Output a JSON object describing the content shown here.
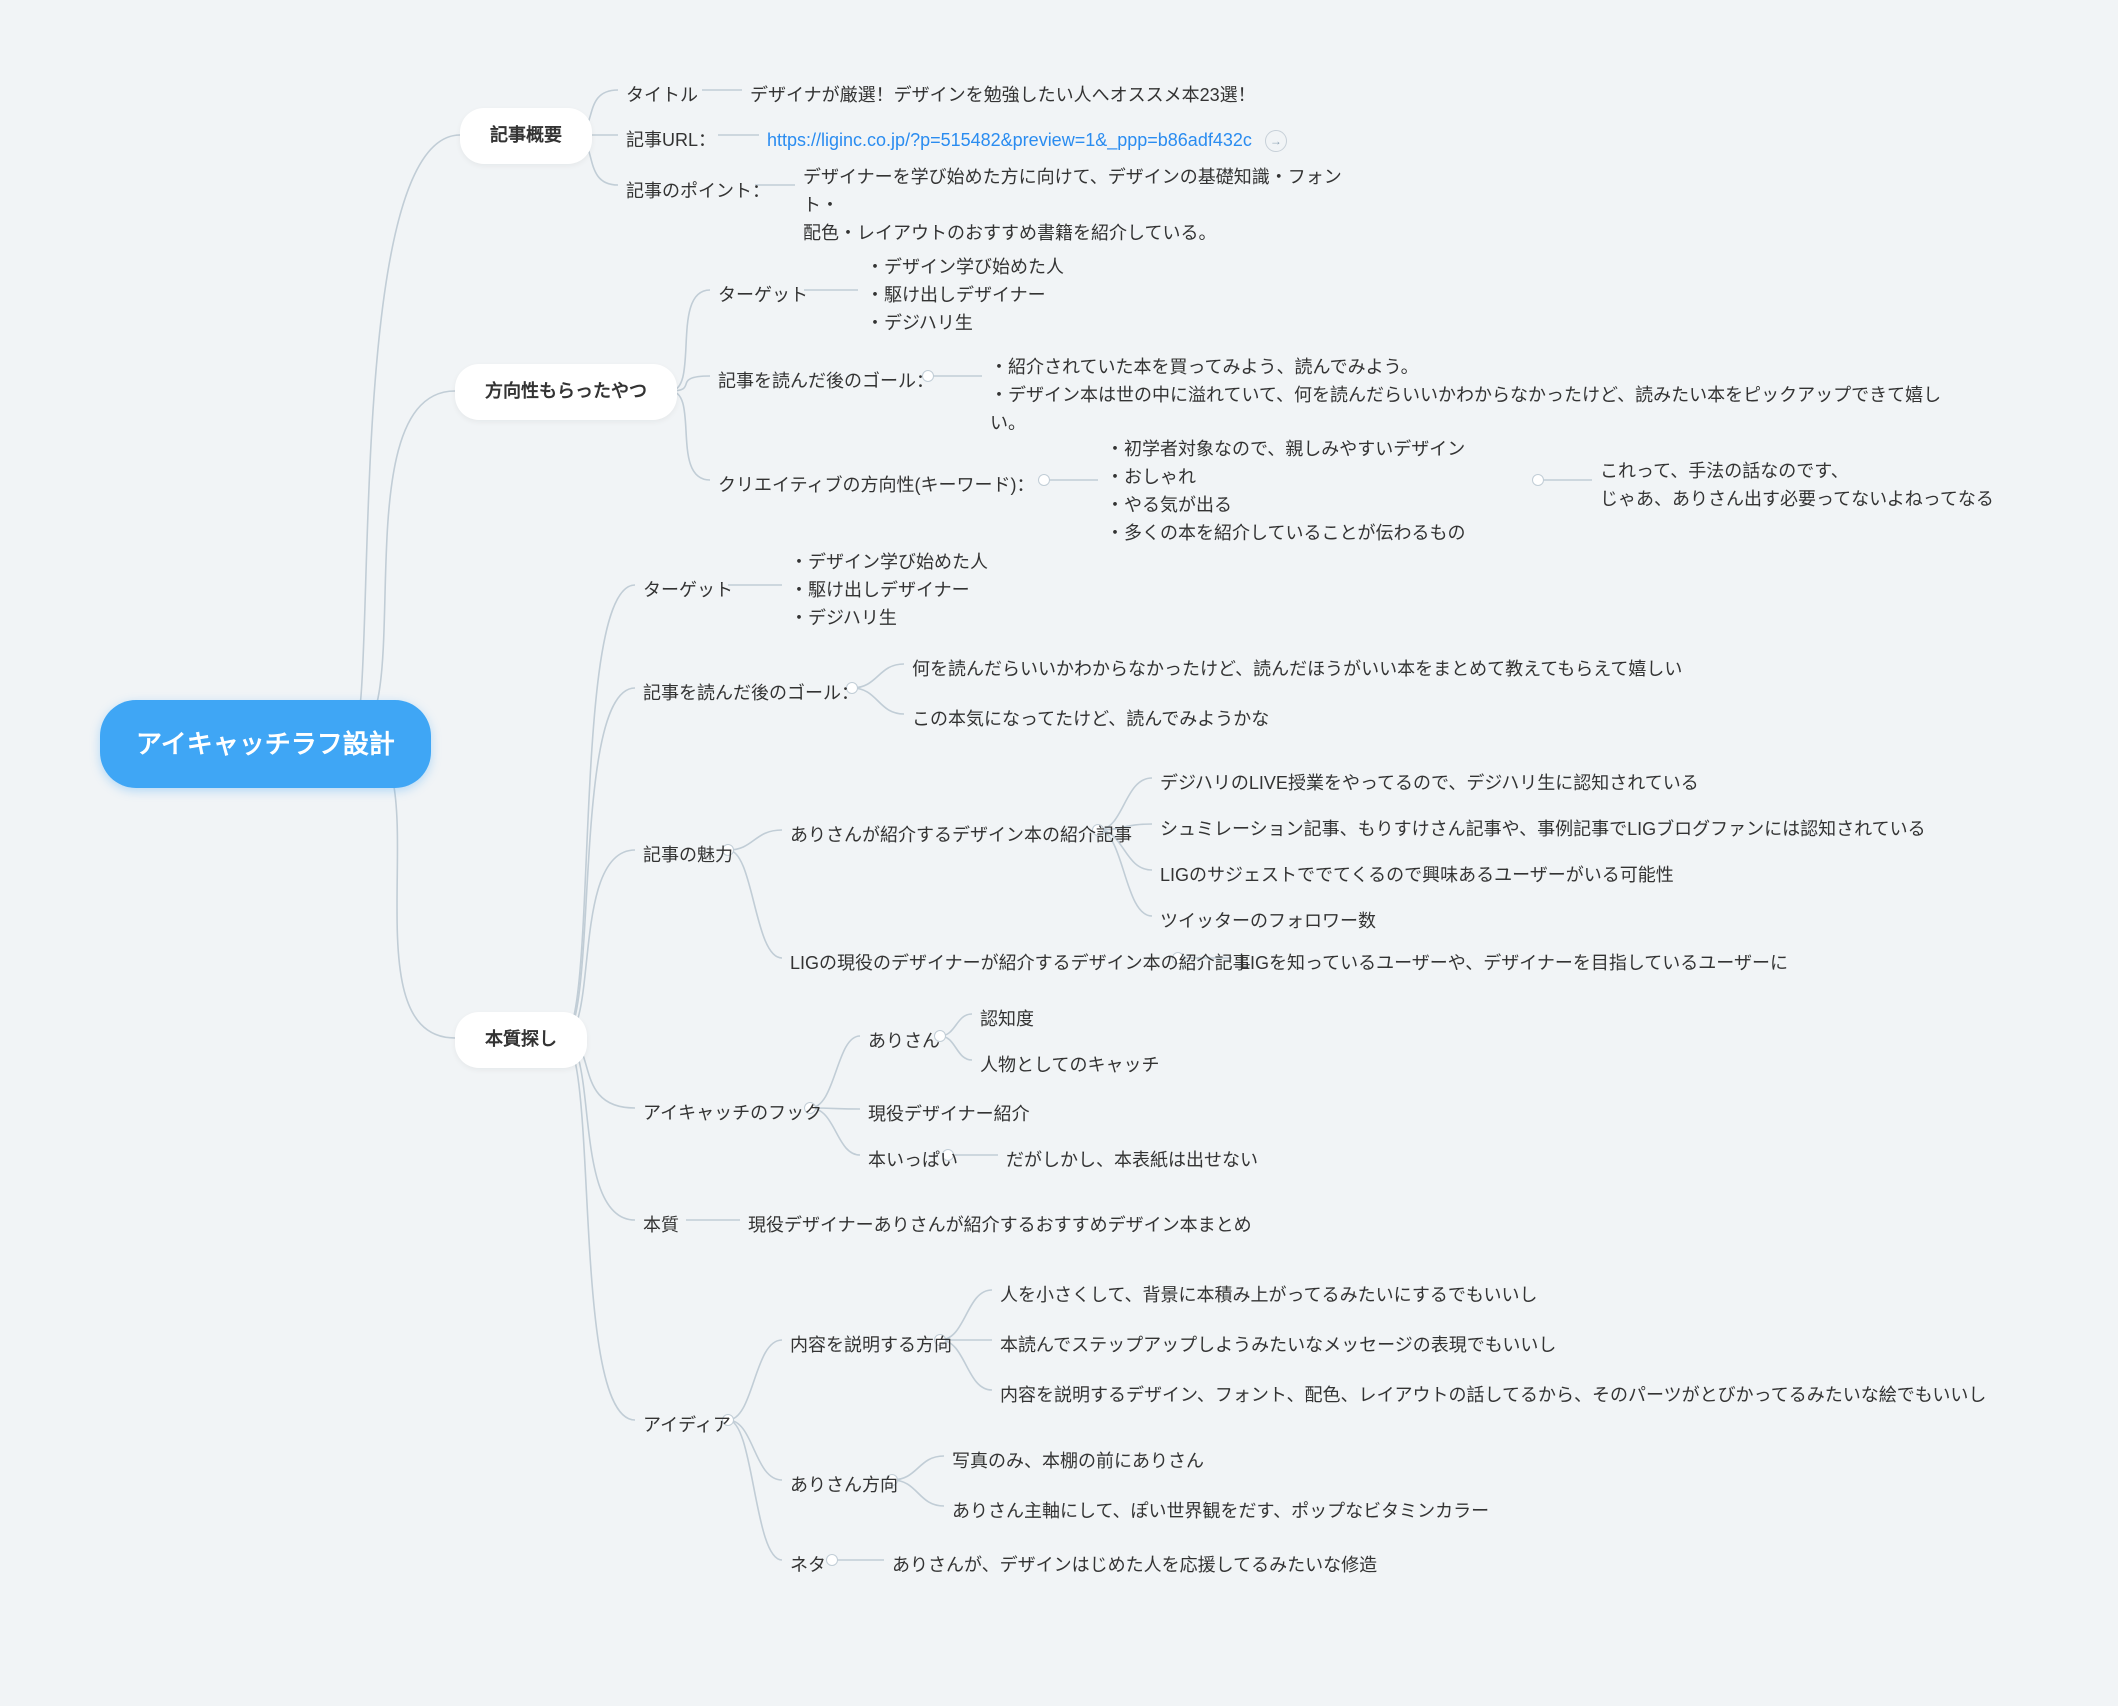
{
  "root": "アイキャッチラフ設計",
  "l1": {
    "overview": "記事概要",
    "direction": "方向性もらったやつ",
    "essence": "本質探し"
  },
  "overview": {
    "title_lbl": "タイトル",
    "title_val": "デザイナが厳選！デザインを勉強したい人へオススメ本23選！",
    "url_lbl": "記事URL：",
    "url_val": "https://liginc.co.jp/?p=515482&preview=1&_ppp=b86adf432c",
    "point_lbl": "記事のポイント：",
    "point_val": "デザイナーを学び始めた方に向けて、デザインの基礎知識・フォント・\n配色・レイアウトのおすすめ書籍を紹介している。"
  },
  "direction": {
    "target_lbl": "ターゲット",
    "target_val": "・デザイン学び始めた人\n・駆け出しデザイナー\n・デジハリ生",
    "goal_lbl": "記事を読んだ後のゴール：",
    "goal_val": "・紹介されていた本を買ってみよう、読んでみよう。\n・デザイン本は世の中に溢れていて、何を読んだらいいかわからなかったけど、読みたい本をピックアップできて嬉しい。",
    "creative_lbl": "クリエイティブの方向性(キーワード)：",
    "creative_val": "・初学者対象なので、親しみやすいデザイン\n・おしゃれ\n・やる気が出る\n・多くの本を紹介していることが伝わるもの",
    "creative_note": "これって、手法の話なのです、\nじゃあ、ありさん出す必要ってないよねってなる"
  },
  "essence": {
    "target_lbl": "ターゲット",
    "target_val": "・デザイン学び始めた人\n・駆け出しデザイナー\n・デジハリ生",
    "goal_lbl": "記事を読んだ後のゴール：",
    "goal_val1": "何を読んだらいいかわからなかったけど、読んだほうがいい本をまとめて教えてもらえて嬉しい",
    "goal_val2": "この本気になってたけど、読んでみようかな",
    "appeal_lbl": "記事の魅力",
    "appeal": {
      "ari_lbl": "ありさんが紹介するデザイン本の紹介記事",
      "ari": {
        "a1": "デジハリのLIVE授業をやってるので、デジハリ生に認知されている",
        "a2": "シュミレーション記事、もりすけさん記事や、事例記事でLIGブログファンには認知されている",
        "a3": "LIGのサジェストででてくるので興味あるユーザーがいる可能性",
        "a4": "ツイッターのフォロワー数"
      },
      "lig_lbl": "LIGの現役のデザイナーが紹介するデザイン本の紹介記事",
      "lig_val": "LIGを知っているユーザーや、デザイナーを目指しているユーザーに"
    },
    "hook_lbl": "アイキャッチのフック",
    "hook": {
      "ari_lbl": "ありさん",
      "ari_a": "認知度",
      "ari_b": "人物としてのキャッチ",
      "active_lbl": "現役デザイナー紹介",
      "books_lbl": "本いっぱい",
      "books_val": "だがしかし、本表紙は出せない"
    },
    "core_lbl": "本質",
    "core_val": "現役デザイナーありさんが紹介するおすすめデザイン本まとめ",
    "idea_lbl": "アイディア",
    "idea": {
      "explain_lbl": "内容を説明する方向",
      "explain": {
        "e1": "人を小さくして、背景に本積み上がってるみたいにするでもいいし",
        "e2": "本読んでステップアップしようみたいなメッセージの表現でもいいし",
        "e3": "内容を説明するデザイン、フォント、配色、レイアウトの話してるから、そのパーツがとびかってるみたいな絵でもいいし"
      },
      "ari_lbl": "ありさん方向",
      "ari": {
        "a1": "写真のみ、本棚の前にありさん",
        "a2": "ありさん主軸にして、ぽい世界観をだす、ポップなビタミンカラー"
      },
      "neta_lbl": "ネタ",
      "neta_val": "ありさんが、デザインはじめた人を応援してるみたいな修造"
    }
  }
}
